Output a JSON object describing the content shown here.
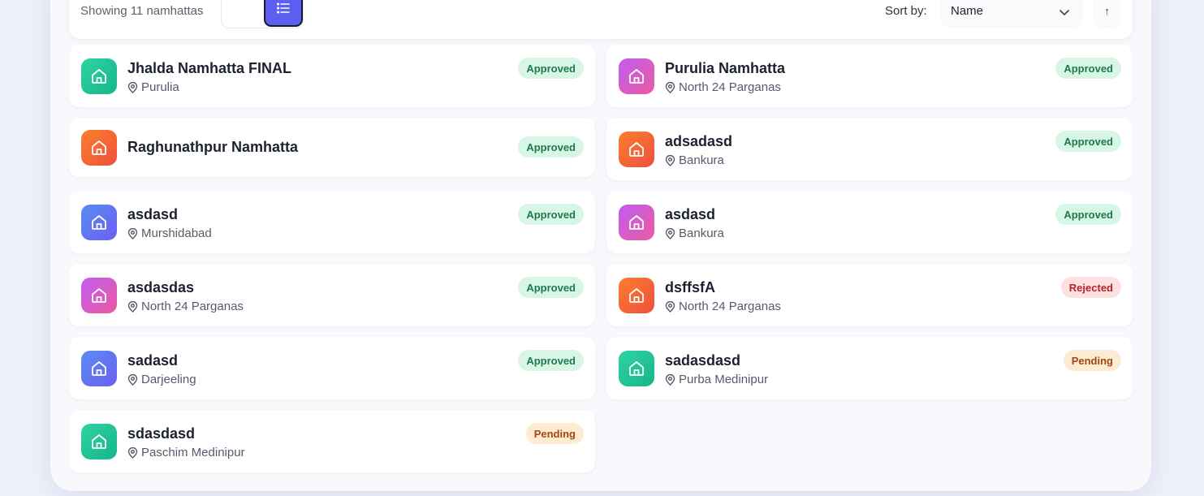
{
  "toolbar": {
    "showing_text": "Showing 11 namhattas",
    "sort_label": "Sort by:",
    "sort_value": "Name",
    "sort_direction": "↑",
    "active_view": "list"
  },
  "cards": [
    {
      "name": "Jhalda Namhatta FINAL",
      "location": "Purulia",
      "status": "Approved",
      "color": "green"
    },
    {
      "name": "Purulia Namhatta",
      "location": "North 24 Parganas",
      "status": "Approved",
      "color": "purple"
    },
    {
      "name": "Raghunathpur Namhatta",
      "location": "",
      "status": "Approved",
      "color": "orange"
    },
    {
      "name": "adsadasd",
      "location": "Bankura",
      "status": "Approved",
      "color": "orange"
    },
    {
      "name": "asdasd",
      "location": "Murshidabad",
      "status": "Approved",
      "color": "blue"
    },
    {
      "name": "asdasd",
      "location": "Bankura",
      "status": "Approved",
      "color": "purple"
    },
    {
      "name": "asdasdas",
      "location": "North 24 Parganas",
      "status": "Approved",
      "color": "purple"
    },
    {
      "name": "dsffsfA",
      "location": "North 24 Parganas",
      "status": "Rejected",
      "color": "orange"
    },
    {
      "name": "sadasd",
      "location": "Darjeeling",
      "status": "Approved",
      "color": "blue"
    },
    {
      "name": "sadasdasd",
      "location": "Purba Medinipur",
      "status": "Pending",
      "color": "green"
    },
    {
      "name": "sdasdasd",
      "location": "Paschim Medinipur",
      "status": "Pending",
      "color": "green"
    }
  ],
  "colors": {
    "accent": "#5b5ef0",
    "approved_bg": "#d8f6e6",
    "rejected_bg": "#fde1e1",
    "pending_bg": "#fdebd2"
  }
}
